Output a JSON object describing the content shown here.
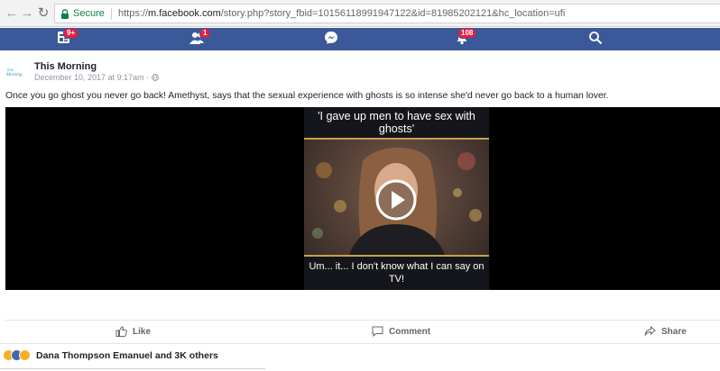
{
  "browser": {
    "secure_label": "Secure",
    "url_prefix": "https://",
    "url_host": "m.facebook.com",
    "url_rest": "/story.php?story_fbid=10156118991947122&id=81985202121&hc_location=ufi"
  },
  "fb_nav": {
    "items": [
      {
        "icon": "news-feed-icon",
        "badge": "9+"
      },
      {
        "icon": "friend-requests-icon",
        "badge": "1"
      },
      {
        "icon": "messenger-icon",
        "badge": ""
      },
      {
        "icon": "notifications-icon",
        "badge": "108"
      },
      {
        "icon": "search-icon",
        "badge": ""
      }
    ]
  },
  "post": {
    "author": "This Morning",
    "avatar_text": "this Morning",
    "timestamp": "December 10, 2017 at 9:17am ·",
    "text": "Once you go ghost you never go back! Amethyst, says that the sexual experience with ghosts is so intense she'd never go back to a human lover.",
    "video": {
      "caption_top": "'I gave up men to have sex with ghosts'",
      "caption_bottom": "Um... it... I don't know what I can say on TV!"
    }
  },
  "actions": {
    "like": "Like",
    "comment": "Comment",
    "share": "Share"
  },
  "reactions": {
    "summary": "Dana Thompson Emanuel and 3K others",
    "types": [
      "haha",
      "like",
      "wow"
    ]
  },
  "colors": {
    "facebook_blue": "#3b5998",
    "badge_red": "#e41e3f",
    "secure_green": "#0b8043"
  }
}
